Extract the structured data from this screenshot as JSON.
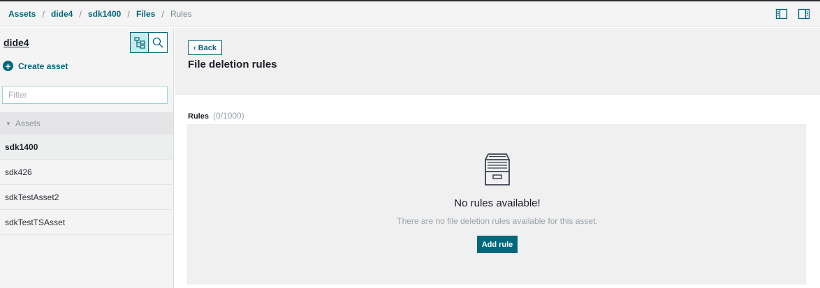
{
  "breadcrumb": {
    "items": [
      "Assets",
      "dide4",
      "sdk1400",
      "Files"
    ],
    "current": "Rules",
    "separator": "/"
  },
  "header": {
    "icons": [
      "sidebar-left-icon",
      "sidebar-right-icon"
    ]
  },
  "sidebar": {
    "title": "dide4",
    "create_asset_label": "Create asset",
    "filter_placeholder": "Filter",
    "tree_header": "Assets",
    "items": [
      {
        "label": "sdk1400",
        "selected": true
      },
      {
        "label": "sdk426",
        "selected": false
      },
      {
        "label": "sdkTestAsset2",
        "selected": false
      },
      {
        "label": "sdkTestTSAsset",
        "selected": false
      }
    ],
    "view_toggle_icons": [
      "hierarchy-icon",
      "search-icon"
    ]
  },
  "main": {
    "back_label": "Back",
    "page_title": "File deletion rules",
    "rules_label": "Rules",
    "rules_count": "(0/1000)",
    "empty_title": "No rules available!",
    "empty_description": "There are no file deletion rules available for this asset.",
    "add_rule_label": "Add rule"
  },
  "colors": {
    "accent": "#00677c",
    "toggle_active": "#c9ebeb",
    "panel_bg": "#f0f0f0",
    "sidebar_bg": "#f4f4f4"
  }
}
